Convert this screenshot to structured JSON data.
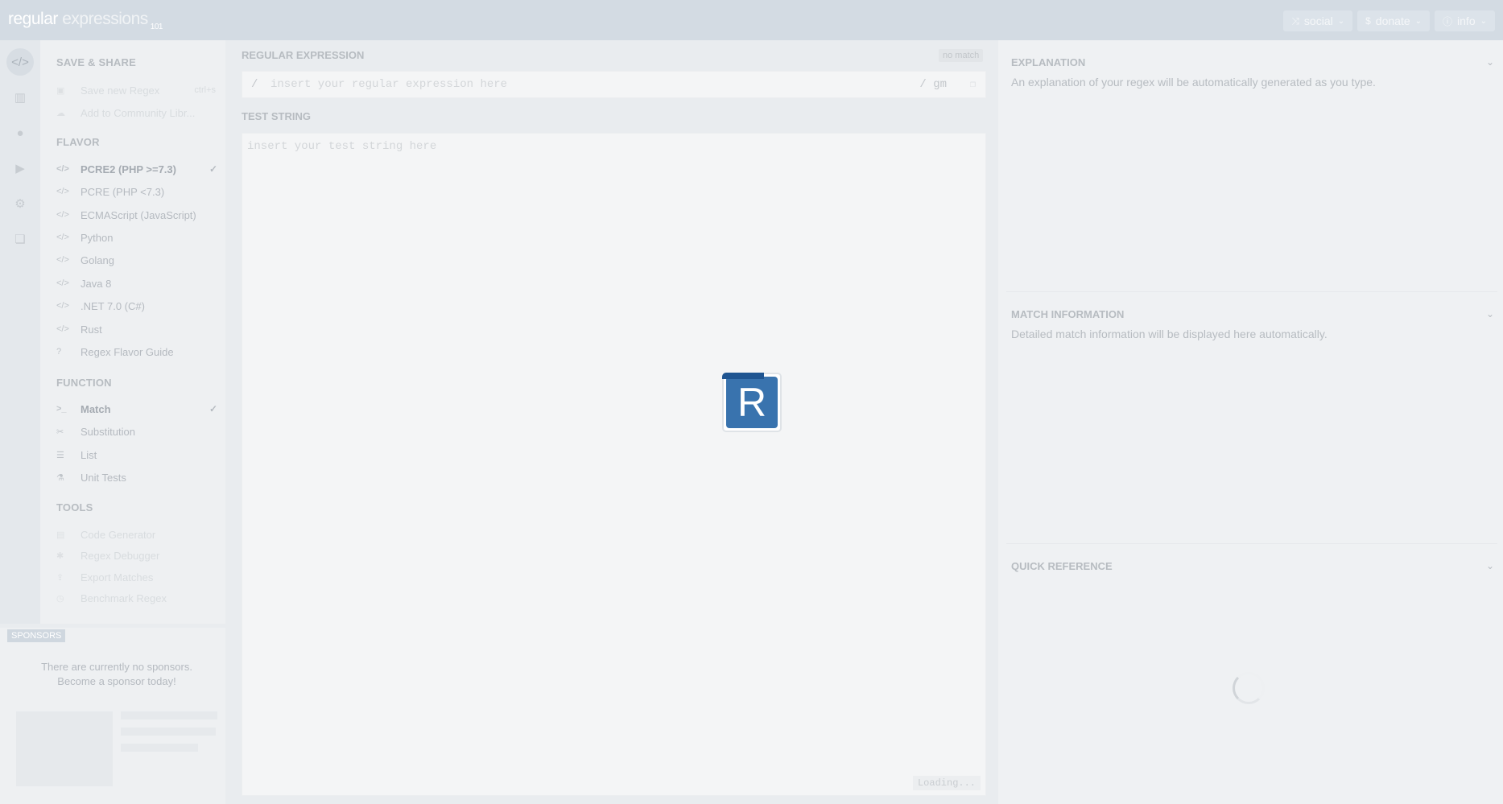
{
  "app": {
    "logo_main": "regular",
    "logo_rest": " expressions",
    "logo_sup": "101"
  },
  "topnav": [
    {
      "icon": "share-icon",
      "label": "social"
    },
    {
      "icon": "dollar-icon",
      "label": "donate"
    },
    {
      "icon": "info-icon",
      "label": "info"
    }
  ],
  "iconbar": [
    "code-icon",
    "chart-icon",
    "user-icon",
    "youtube-icon",
    "gear-icon",
    "chat-icon"
  ],
  "sidebar": {
    "save_share": {
      "title": "SAVE & SHARE",
      "items": [
        {
          "label": "Save new Regex",
          "shortcut": "ctrl+s"
        },
        {
          "label": "Add to Community Libr..."
        }
      ]
    },
    "flavor": {
      "title": "FLAVOR",
      "items": [
        {
          "label": "PCRE2 (PHP >=7.3)",
          "selected": true
        },
        {
          "label": "PCRE (PHP <7.3)"
        },
        {
          "label": "ECMAScript (JavaScript)"
        },
        {
          "label": "Python"
        },
        {
          "label": "Golang"
        },
        {
          "label": "Java 8"
        },
        {
          "label": ".NET 7.0 (C#)"
        },
        {
          "label": "Rust"
        },
        {
          "label": "Regex Flavor Guide"
        }
      ]
    },
    "function": {
      "title": "FUNCTION",
      "items": [
        {
          "label": "Match",
          "selected": true
        },
        {
          "label": "Substitution"
        },
        {
          "label": "List"
        },
        {
          "label": "Unit Tests"
        }
      ]
    },
    "tools": {
      "title": "TOOLS",
      "items": [
        {
          "label": "Code Generator"
        },
        {
          "label": "Regex Debugger"
        },
        {
          "label": "Export Matches"
        },
        {
          "label": "Benchmark Regex"
        }
      ]
    }
  },
  "sponsors": {
    "tag": "SPONSORS",
    "line1": "There are currently no sponsors.",
    "line2": "Become a sponsor today!"
  },
  "editor": {
    "regex_label": "REGULAR EXPRESSION",
    "match_status": "no match",
    "delimiter_open": "/",
    "regex_placeholder": "insert your regular expression here",
    "flags": "/ gm",
    "test_label": "TEST STRING",
    "test_placeholder": "insert your test string here",
    "loading": "Loading..."
  },
  "right": {
    "explanation": {
      "title": "EXPLANATION",
      "text": "An explanation of your regex will be automatically generated as you type."
    },
    "match_info": {
      "title": "MATCH INFORMATION",
      "text": "Detailed match information will be displayed here automatically."
    },
    "quick_ref": {
      "title": "QUICK REFERENCE"
    }
  },
  "loader": {
    "letter": "R"
  },
  "colors": {
    "accent": "#3973ae",
    "accent_dark": "#1f5591",
    "topbar": "#d3dbe3"
  }
}
